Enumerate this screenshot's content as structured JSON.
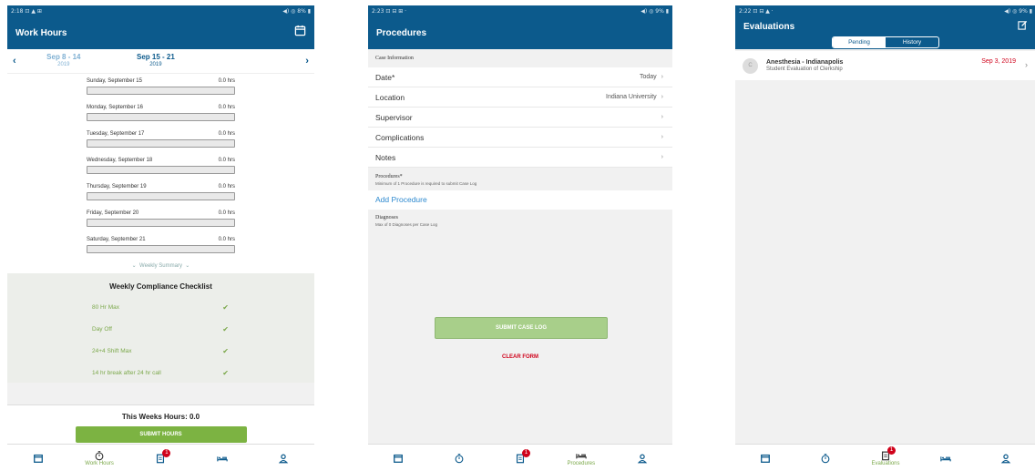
{
  "p1": {
    "status_time": "2:18 ⊡ ▲ ⊞",
    "status_right": "◀) ◎ 8% ▮",
    "title": "Work Hours",
    "prev_week": "Sep 8 - 14",
    "prev_year": "2019",
    "cur_week": "Sep 15 - 21",
    "cur_year": "2019",
    "days": [
      {
        "name": "Sunday, September 15",
        "hours": "0.0 hrs"
      },
      {
        "name": "Monday, September 16",
        "hours": "0.0 hrs"
      },
      {
        "name": "Tuesday, September 17",
        "hours": "0.0 hrs"
      },
      {
        "name": "Wednesday, September 18",
        "hours": "0.0 hrs"
      },
      {
        "name": "Thursday, September 19",
        "hours": "0.0 hrs"
      },
      {
        "name": "Friday, September 20",
        "hours": "0.0 hrs"
      },
      {
        "name": "Saturday, September 21",
        "hours": "0.0 hrs"
      }
    ],
    "weekly_summary": "Weekly Summary",
    "compliance_title": "Weekly Compliance Checklist",
    "compliance": [
      "80 Hr Max",
      "Day Off",
      "24+4 Shift Max",
      "14 hr break after 24 hr call"
    ],
    "weeks_hours": "This Weeks Hours: 0.0",
    "submit": "SUBMIT HOURS",
    "tab_label": "Work Hours",
    "badge": "1"
  },
  "p2": {
    "status_time": "2:23 ⊡ ⊟ ⊞ ·",
    "status_right": "◀) ◎ 9% ▮",
    "title": "Procedures",
    "case_info": "Case Information",
    "rows": [
      {
        "label": "Date*",
        "value": "Today"
      },
      {
        "label": "Location",
        "value": "Indiana University"
      },
      {
        "label": "Supervisor",
        "value": ""
      },
      {
        "label": "Complications",
        "value": ""
      },
      {
        "label": "Notes",
        "value": ""
      }
    ],
    "procedures_head": "Procedures*",
    "procedures_desc": "Minimum of 1 Procedure is required to submit Case Log",
    "add_procedure": "Add Procedure",
    "diagnoses_head": "Diagnoses",
    "diagnoses_desc": "Max of 0 Diagnoses per Case Log",
    "submit": "SUBMIT CASE LOG",
    "clear": "CLEAR FORM",
    "tab_label": "Procedures",
    "badge": "1"
  },
  "p3": {
    "status_time": "2:22 ⊡ ⊟ ▲ ·",
    "status_right": "◀) ◎ 9% ▮",
    "title": "Evaluations",
    "seg_pending": "Pending",
    "seg_history": "History",
    "avatar": "C",
    "eval_title": "Anesthesia - Indianapolis",
    "eval_sub": "Student Evaluation of Clerkship",
    "eval_date": "Sep 3, 2019",
    "tab_label": "Evaluations",
    "badge": "1"
  },
  "colors": {
    "brand": "#0c5a8c",
    "green": "#7cb342",
    "alert": "#d0021b"
  }
}
